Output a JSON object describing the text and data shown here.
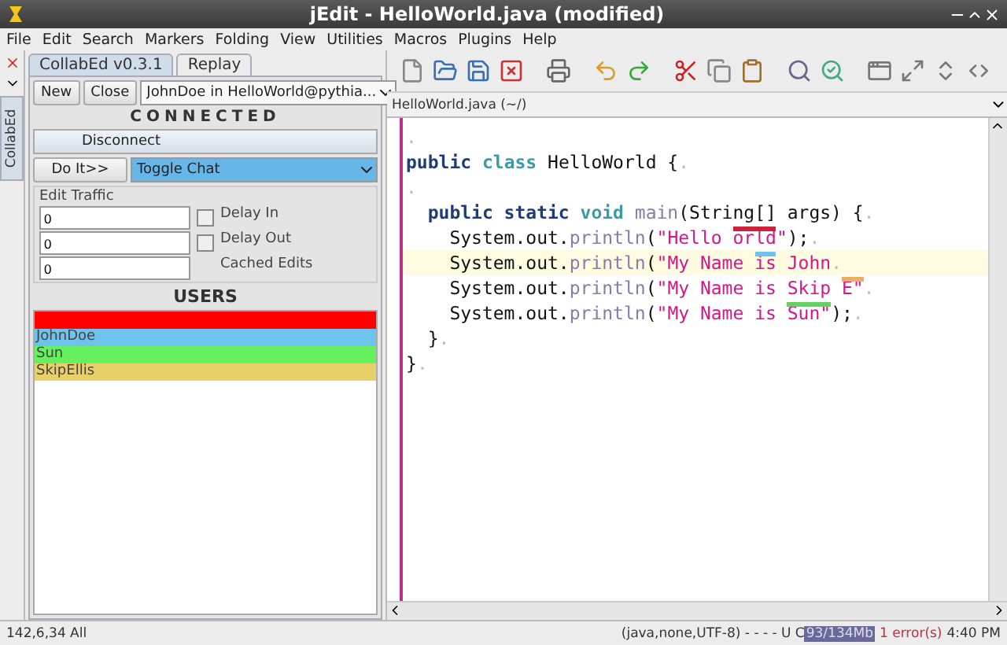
{
  "window": {
    "title": "jEdit - HelloWorld.java (modified)"
  },
  "menu": [
    "File",
    "Edit",
    "Search",
    "Markers",
    "Folding",
    "View",
    "Utilities",
    "Macros",
    "Plugins",
    "Help"
  ],
  "dock": {
    "label": "CollabEd"
  },
  "panel": {
    "tabs": [
      {
        "label": "CollabEd v0.3.1",
        "selected": true
      },
      {
        "label": "Replay",
        "selected": false
      }
    ],
    "buttons": [
      "New",
      "Close"
    ],
    "session": "JohnDoe in HelloWorld@pythia...",
    "status": "CONNECTED",
    "disconnect": "Disconnect",
    "action_button": "Do It>>",
    "action": "Toggle Chat",
    "traffic": {
      "title": "Edit Traffic",
      "rows": [
        {
          "value": "0",
          "label": "Delay In",
          "kind": "checkbox",
          "checked": false
        },
        {
          "value": "0",
          "label": "Delay Out",
          "kind": "checkbox",
          "checked": false
        },
        {
          "value": "0",
          "label": "Cached Edits",
          "kind": "text"
        }
      ]
    },
    "users_title": "USERS",
    "users": [
      {
        "color": "#ff0000"
      },
      {
        "name": "JohnDoe",
        "color": "#6ec3ec"
      },
      {
        "name": "Sun",
        "color": "#66f060"
      },
      {
        "name": "SkipEllis",
        "color": "#e8d068"
      }
    ]
  },
  "buffer_tab": {
    "label": "HelloWorld.java (~/)"
  },
  "code": [
    {
      "current": false,
      "tokens": [
        {
          "kind": "eol",
          "t": "."
        }
      ]
    },
    {
      "current": false,
      "tokens": [
        {
          "kind": "kw",
          "t": "public "
        },
        {
          "kind": "kw2",
          "t": "class"
        },
        {
          "kind": "plain",
          "t": " HelloWorld {"
        },
        {
          "kind": "eol",
          "t": "."
        }
      ]
    },
    {
      "current": false,
      "tokens": [
        {
          "kind": "eol",
          "t": "."
        }
      ]
    },
    {
      "current": false,
      "tokens": [
        {
          "kind": "kw",
          "t": "  public static "
        },
        {
          "kind": "kw2",
          "t": "void "
        },
        {
          "kind": "fn",
          "t": "main"
        },
        {
          "kind": "plain",
          "t": "(String[] args) {"
        },
        {
          "kind": "eol",
          "t": "."
        }
      ]
    },
    {
      "current": false,
      "tokens": [
        {
          "kind": "plain",
          "t": "    System.out."
        },
        {
          "kind": "fn",
          "t": "println"
        },
        {
          "kind": "plain",
          "t": "("
        },
        {
          "kind": "str",
          "t": "\"Hello "
        },
        {
          "kind": "str",
          "t": "orld",
          "color": "#d0203a"
        },
        {
          "kind": "str",
          "t": "\""
        },
        {
          "kind": "plain",
          "t": ");"
        },
        {
          "kind": "eol",
          "t": "."
        }
      ]
    },
    {
      "current": true,
      "tokens": [
        {
          "kind": "plain",
          "t": "    System.out."
        },
        {
          "kind": "fn",
          "t": "println"
        },
        {
          "kind": "plain",
          "t": "("
        },
        {
          "kind": "str",
          "t": "\"My Name "
        },
        {
          "kind": "str",
          "t": "is",
          "color": "#6ec3ec"
        },
        {
          "kind": "str",
          "t": " John"
        },
        {
          "kind": "eol",
          "t": "."
        }
      ]
    },
    {
      "current": false,
      "tokens": [
        {
          "kind": "plain",
          "t": "    System.out."
        },
        {
          "kind": "fn",
          "t": "println"
        },
        {
          "kind": "plain",
          "t": "("
        },
        {
          "kind": "str",
          "t": "\"My Name is Skip "
        },
        {
          "kind": "str",
          "t": "E\"",
          "color": "#e8b060"
        },
        {
          "kind": "eol",
          "t": "."
        }
      ]
    },
    {
      "current": false,
      "tokens": [
        {
          "kind": "plain",
          "t": "    System.out."
        },
        {
          "kind": "fn",
          "t": "println"
        },
        {
          "kind": "plain",
          "t": "("
        },
        {
          "kind": "str",
          "t": "\"My Name is "
        },
        {
          "kind": "str",
          "t": "Sun\"",
          "color": "#66d060"
        },
        {
          "kind": "plain",
          "t": ");"
        },
        {
          "kind": "eol",
          "t": "."
        }
      ]
    },
    {
      "current": false,
      "tokens": [
        {
          "kind": "plain",
          "t": "  }"
        },
        {
          "kind": "eol",
          "t": "."
        }
      ]
    },
    {
      "current": false,
      "tokens": [
        {
          "kind": "plain",
          "t": "}"
        },
        {
          "kind": "eol",
          "t": "."
        }
      ]
    }
  ],
  "status_bar": {
    "position": "142,6,34 All",
    "mode": "(java,none,UTF-8) - - - - U C",
    "memory": "93/134Mb",
    "errors": "1 error(s)",
    "time": "4:40 PM"
  }
}
